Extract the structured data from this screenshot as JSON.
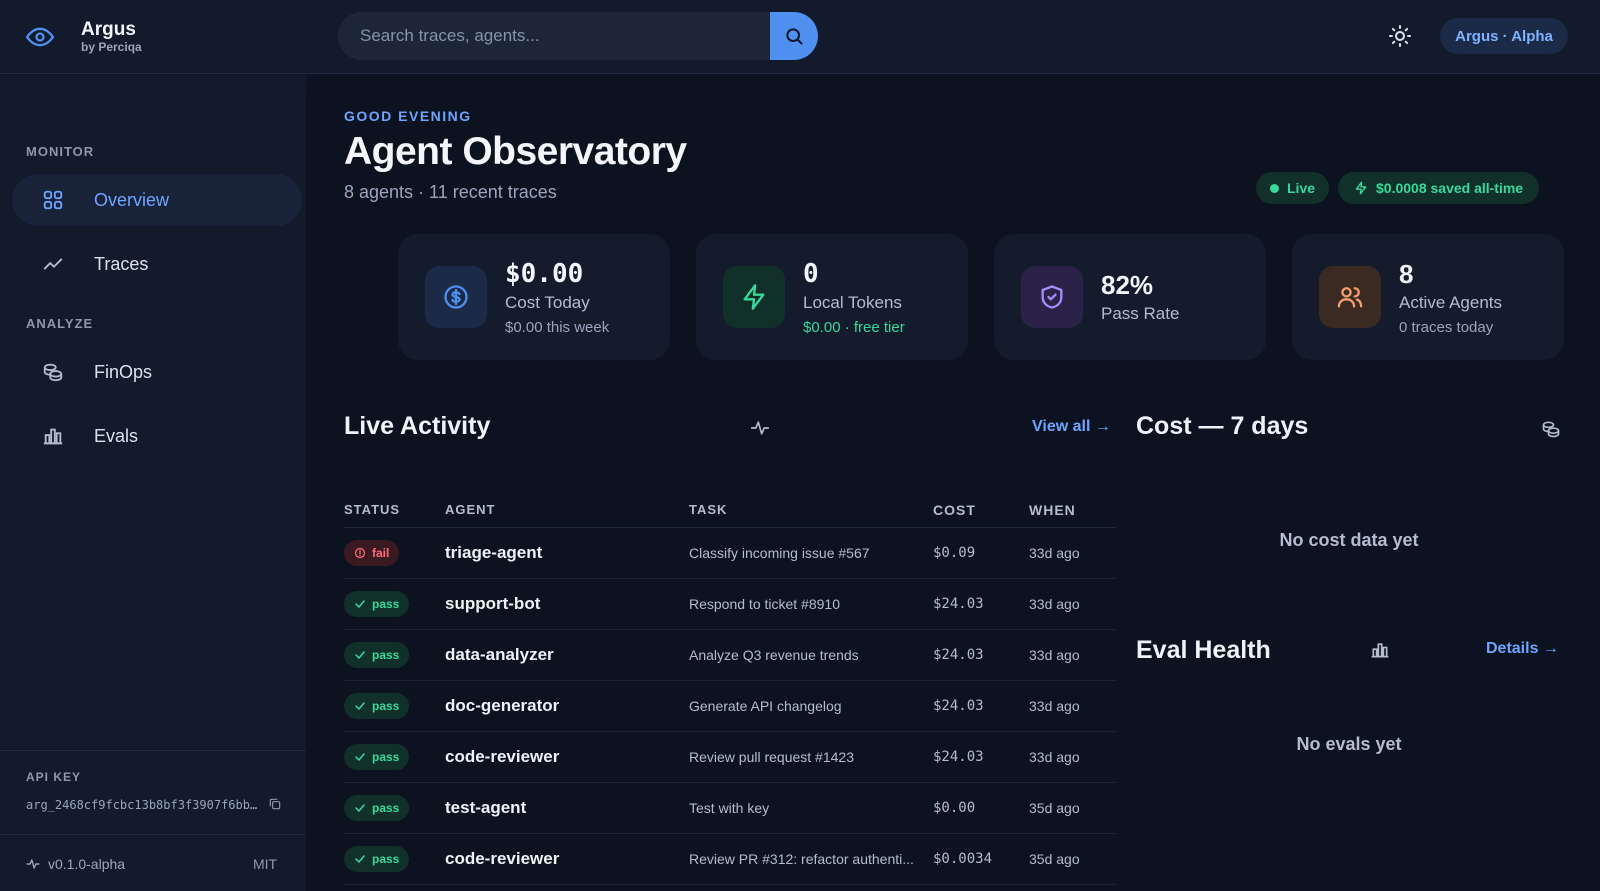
{
  "brand": {
    "name": "Argus",
    "sub": "by Perciqa"
  },
  "search": {
    "placeholder": "Search traces, agents..."
  },
  "user": {
    "label": "Argus · Alpha"
  },
  "sidebar": {
    "sections": [
      {
        "label": "MONITOR"
      },
      {
        "label": "ANALYZE"
      }
    ],
    "items": [
      {
        "label": "Overview",
        "icon": "grid-icon",
        "active": true
      },
      {
        "label": "Traces",
        "icon": "trend-icon"
      },
      {
        "label": "FinOps",
        "icon": "coins-icon"
      },
      {
        "label": "Evals",
        "icon": "bar-chart-icon"
      }
    ],
    "api_key_label": "API KEY",
    "api_key_value": "arg_2468cf9fcbc13b8bf3f3907f6bb0...",
    "version": "v0.1.0-alpha",
    "license": "MIT"
  },
  "header": {
    "greeting": "GOOD EVENING",
    "title": "Agent Observatory",
    "subtitle": "8 agents · 11 recent traces",
    "live": "Live",
    "saved": "$0.0008 saved all-time"
  },
  "stats": [
    {
      "value": "$0.00",
      "label": "Cost Today",
      "sub": "$0.00 this week",
      "icon": "dollar-icon",
      "color": "#4f8ff0"
    },
    {
      "value": "0",
      "label": "Local Tokens",
      "sub": "$0.00 · free tier",
      "icon": "bolt-icon",
      "color": "#38d99a"
    },
    {
      "value": "82%",
      "label": "Pass Rate",
      "sub": "",
      "icon": "shield-icon",
      "color": "#a78bfa"
    },
    {
      "value": "8",
      "label": "Active Agents",
      "sub": "0 traces today",
      "icon": "users-icon",
      "color": "#f59e6b"
    }
  ],
  "activity": {
    "title": "Live Activity",
    "view_all": "View all →",
    "columns": [
      "STATUS",
      "AGENT",
      "TASK",
      "COST",
      "WHEN"
    ],
    "rows": [
      {
        "status": "fail",
        "agent": "triage-agent",
        "task": "Classify incoming issue #567",
        "cost": "$0.09",
        "when": "33d ago"
      },
      {
        "status": "pass",
        "agent": "support-bot",
        "task": "Respond to ticket #8910",
        "cost": "$24.03",
        "when": "33d ago"
      },
      {
        "status": "pass",
        "agent": "data-analyzer",
        "task": "Analyze Q3 revenue trends",
        "cost": "$24.03",
        "when": "33d ago"
      },
      {
        "status": "pass",
        "agent": "doc-generator",
        "task": "Generate API changelog",
        "cost": "$24.03",
        "when": "33d ago"
      },
      {
        "status": "pass",
        "agent": "code-reviewer",
        "task": "Review pull request #1423",
        "cost": "$24.03",
        "when": "33d ago"
      },
      {
        "status": "pass",
        "agent": "test-agent",
        "task": "Test with key",
        "cost": "$0.00",
        "when": "35d ago"
      },
      {
        "status": "pass",
        "agent": "code-reviewer",
        "task": "Review PR #312: refactor authenti...",
        "cost": "$0.0034",
        "when": "35d ago"
      }
    ]
  },
  "cost_panel": {
    "title": "Cost — 7 days",
    "empty": "No cost data yet"
  },
  "eval_panel": {
    "title": "Eval Health",
    "details": "Details →",
    "empty": "No evals yet"
  }
}
